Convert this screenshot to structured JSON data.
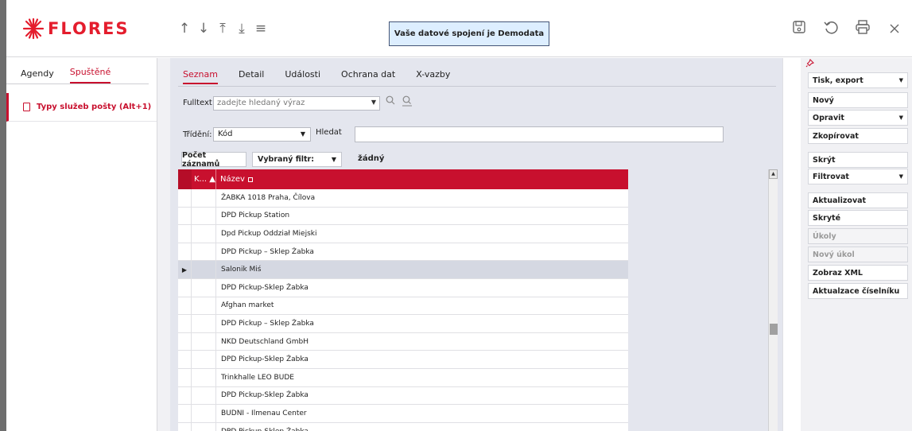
{
  "app": {
    "brand": "FLORES"
  },
  "toolbar": {
    "nav": [
      "↑",
      "↓",
      "⤒",
      "⤓",
      "≡"
    ],
    "banner": "Vaše datové spojení je Demodata",
    "right_icons": [
      "save",
      "undo",
      "print",
      "close"
    ]
  },
  "left": {
    "tabs": [
      {
        "label": "Agendy",
        "active": false
      },
      {
        "label": "Spuštěné",
        "active": true
      }
    ],
    "item": "Typy služeb pošty (Alt+1)"
  },
  "center": {
    "tabs": [
      {
        "label": "Seznam",
        "active": true
      },
      {
        "label": "Detail",
        "active": false
      },
      {
        "label": "Události",
        "active": false
      },
      {
        "label": "Ochrana dat",
        "active": false
      },
      {
        "label": "X-vazby",
        "active": false
      }
    ],
    "fulltext_label": "Fulltext",
    "fulltext_placeholder": "zadejte hledaný výraz",
    "trideni_label": "Třídění:",
    "trideni_value": "Kód",
    "hledat_label": "Hledat",
    "pocet_label": "Počet záznamů",
    "filter_label": "Vybraný filtr:",
    "filter_value": "žádný"
  },
  "grid": {
    "columns": [
      "K...",
      "Název"
    ],
    "rows": [
      "ŽABKA 1018 Praha, Čílova",
      "DPD Pickup Station",
      "Dpd Pickup Oddział Miejski",
      "DPD Pickup – Sklep Żabka",
      "Salonik Miś",
      "DPD Pickup-Sklep Żabka",
      "Afghan market",
      "DPD Pickup – Sklep Żabka",
      "NKD Deutschland GmbH",
      "DPD Pickup-Sklep Żabka",
      "Trinkhalle LEO BUDE",
      "DPD Pickup-Sklep Żabka",
      "BUDNI - Ilmenau Center",
      "DPD Pickup-Sklep Żabka"
    ],
    "current_row": 4
  },
  "actions": [
    {
      "label": "Tisk, export",
      "dropdown": true,
      "disabled": false
    },
    {
      "label": "Nový",
      "dropdown": false,
      "disabled": false
    },
    {
      "label": "Opravit",
      "dropdown": true,
      "disabled": false
    },
    {
      "label": "Zkopírovat",
      "dropdown": false,
      "disabled": false
    },
    {
      "label": "Skrýt",
      "dropdown": false,
      "disabled": false
    },
    {
      "label": "Filtrovat",
      "dropdown": true,
      "disabled": false
    },
    {
      "label": "Aktualizovat",
      "dropdown": false,
      "disabled": false
    },
    {
      "label": "Skryté",
      "dropdown": false,
      "disabled": false
    },
    {
      "label": "Úkoly",
      "dropdown": false,
      "disabled": true
    },
    {
      "label": "Nový úkol",
      "dropdown": false,
      "disabled": true
    },
    {
      "label": "Zobraz XML",
      "dropdown": false,
      "disabled": false
    },
    {
      "label": "Aktualzace číselníku",
      "dropdown": false,
      "disabled": false
    }
  ],
  "colors": {
    "accent": "#c8102e",
    "logo": "#e41d2d",
    "panel": "#e4e6ee"
  }
}
